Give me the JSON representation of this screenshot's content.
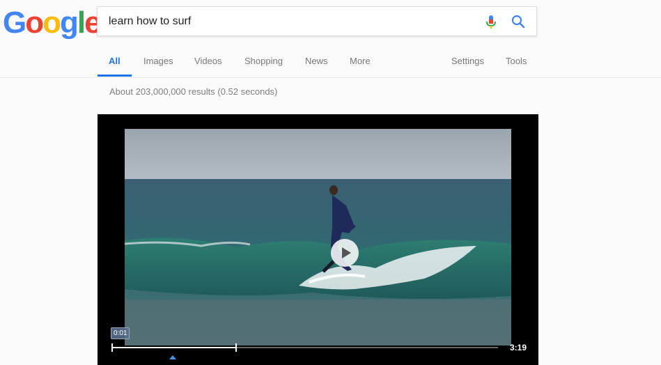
{
  "logo": {
    "letters": [
      "G",
      "o",
      "o",
      "g",
      "l",
      "e"
    ],
    "colors": [
      "#4285F4",
      "#EA4335",
      "#FBBC05",
      "#4285F4",
      "#34A853",
      "#EA4335"
    ]
  },
  "search": {
    "query": "learn how to surf"
  },
  "tabs": [
    {
      "label": "All",
      "active": true
    },
    {
      "label": "Images"
    },
    {
      "label": "Videos"
    },
    {
      "label": "Shopping"
    },
    {
      "label": "News"
    },
    {
      "label": "More"
    },
    {
      "label": "Settings"
    },
    {
      "label": "Tools"
    }
  ],
  "results": {
    "stats": "About 203,000,000 results (0.52 seconds)"
  },
  "video": {
    "current_time": "0:01",
    "duration": "3:19",
    "progress": 0.32
  },
  "colors": {
    "accent": "#1a73e8",
    "tab_text": "#777777",
    "stats_text": "#808080"
  }
}
